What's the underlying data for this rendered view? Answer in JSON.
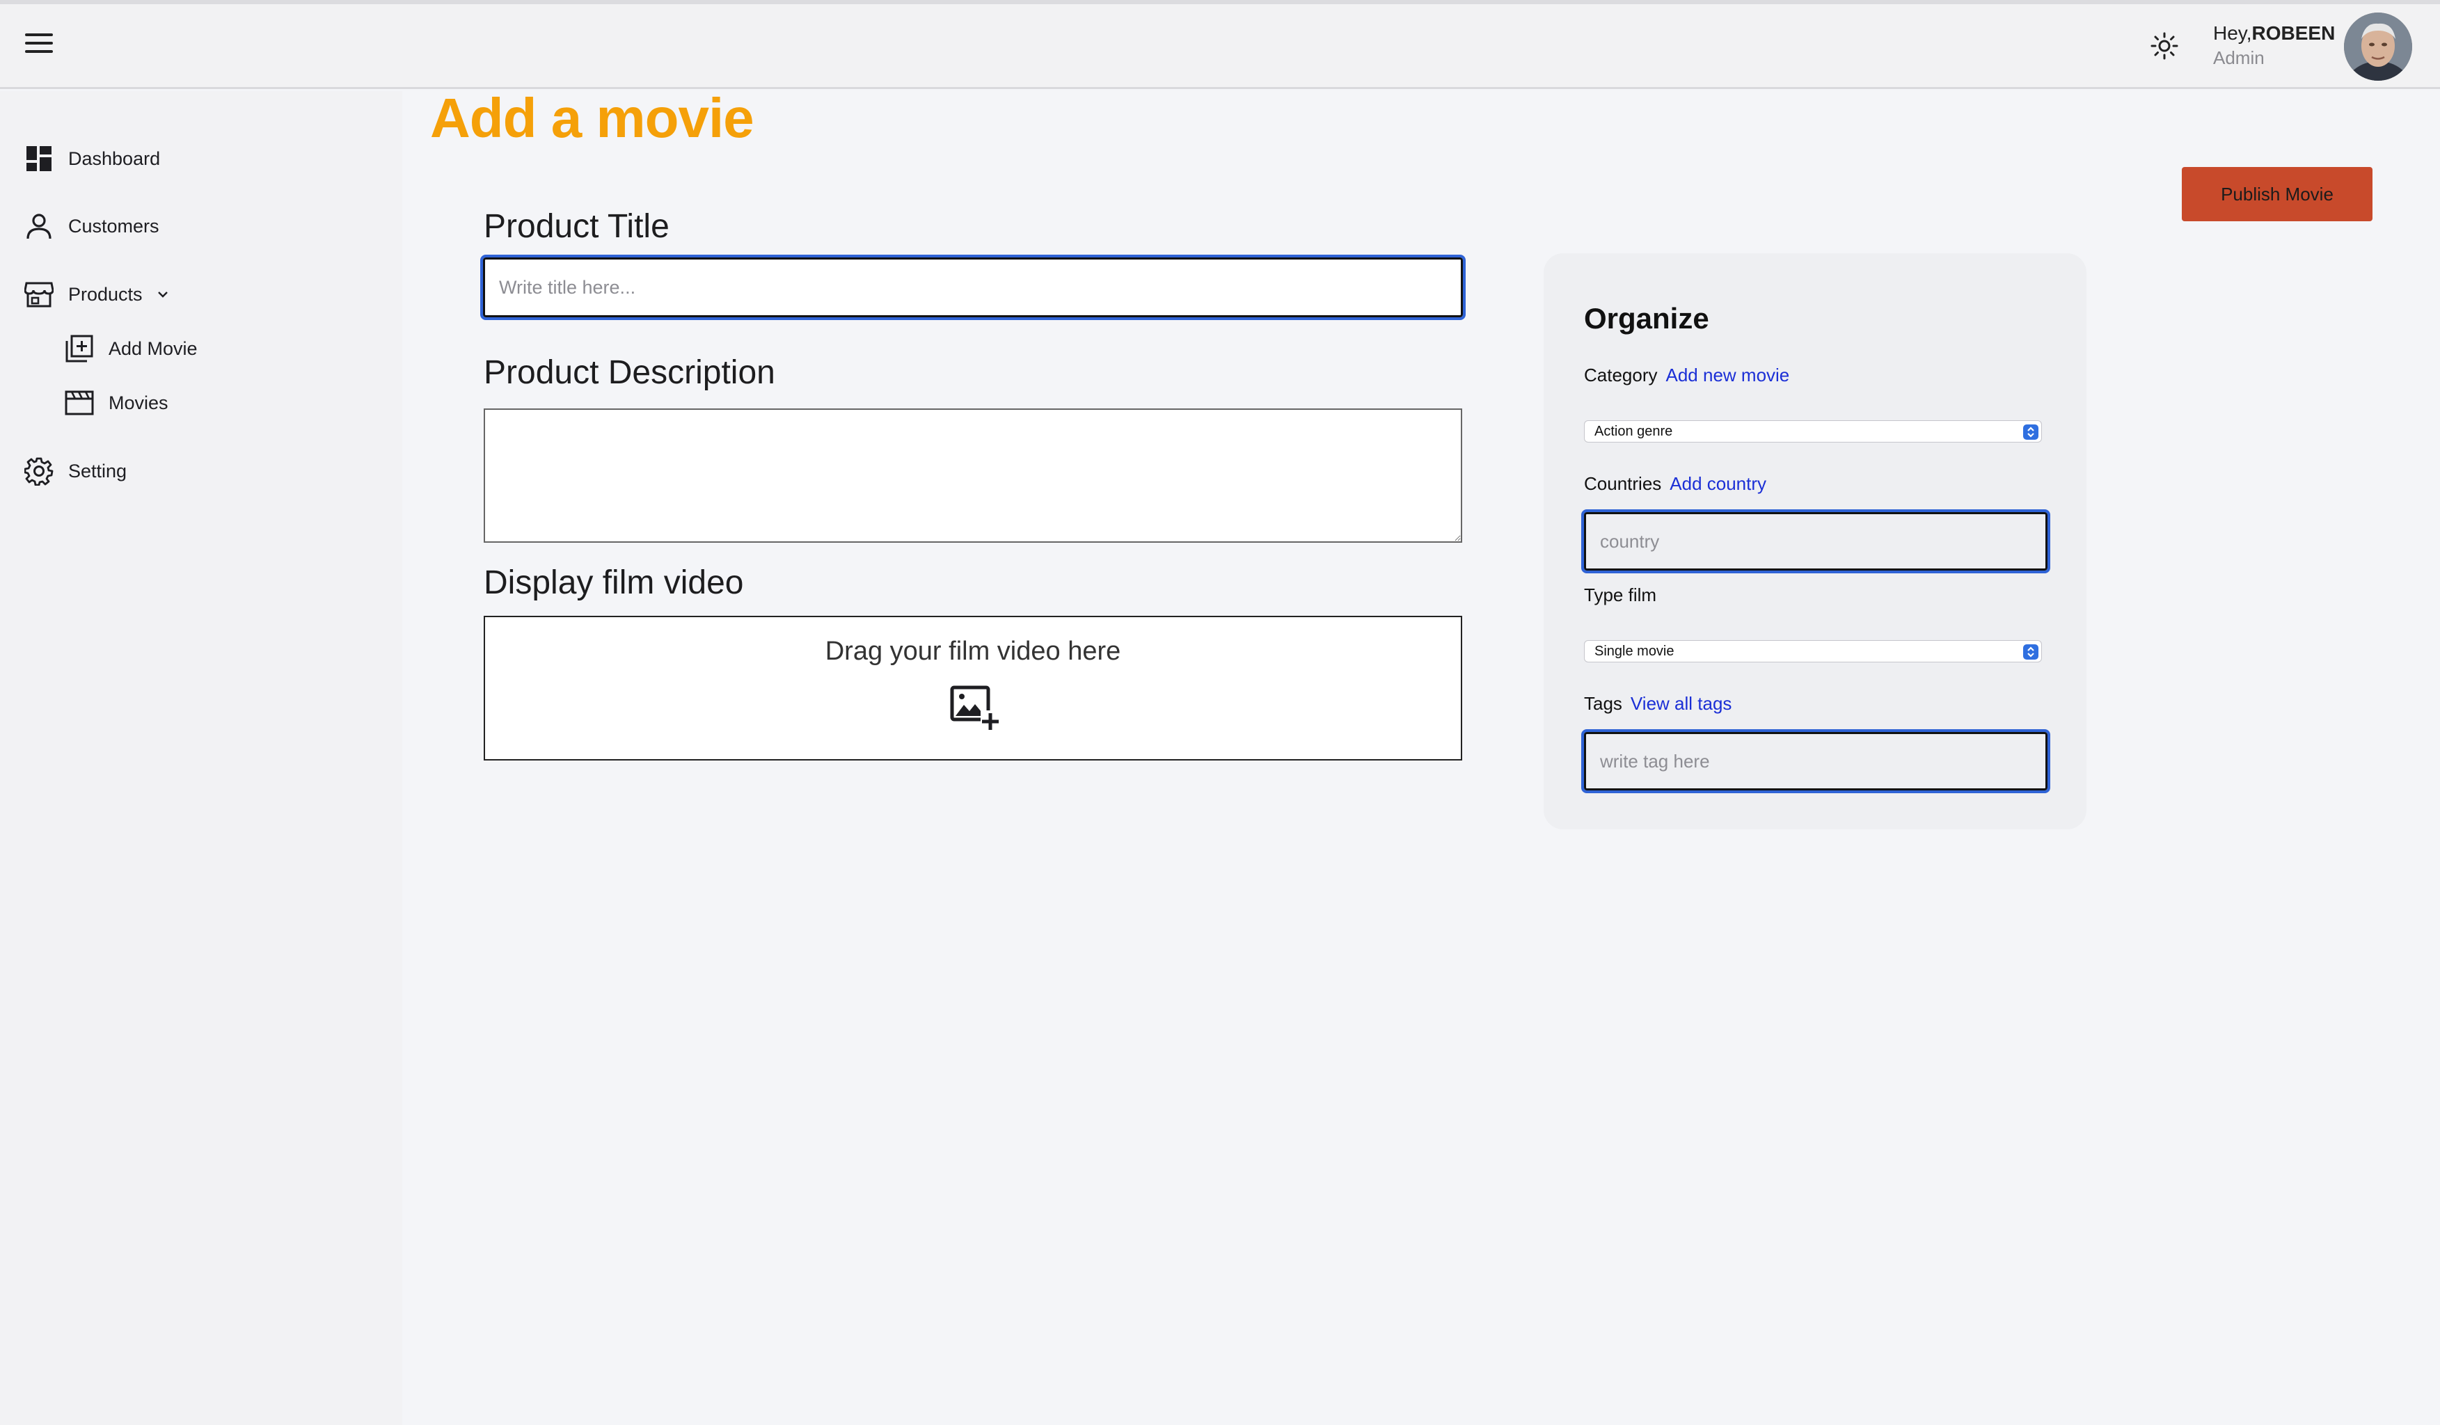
{
  "header": {
    "greeting_prefix": "Hey,",
    "user_name": "ROBEEN",
    "user_role": "Admin",
    "menu_icon": "hamburger-icon",
    "theme_icon": "sun-icon"
  },
  "sidebar": {
    "items": [
      {
        "label": "Dashboard",
        "icon": "dashboard-icon"
      },
      {
        "label": "Customers",
        "icon": "user-icon"
      },
      {
        "label": "Products",
        "icon": "store-icon"
      },
      {
        "label": "Add Movie",
        "icon": "add-box-icon"
      },
      {
        "label": "Movies",
        "icon": "clapperboard-icon"
      },
      {
        "label": "Setting",
        "icon": "gear-icon"
      }
    ]
  },
  "main": {
    "page_title": "Add a movie",
    "publish_label": "Publish Movie",
    "product_title_label": "Product Title",
    "product_title_placeholder": "Write title here...",
    "product_description_label": "Product Description",
    "display_video_label": "Display film video",
    "dropzone_text": "Drag your film video here"
  },
  "organize": {
    "title": "Organize",
    "category_label": "Category",
    "category_link": "Add new movie",
    "category_value": "Action genre",
    "countries_label": "Countries",
    "countries_link": "Add country",
    "country_placeholder": "country",
    "type_label": "Type film",
    "type_value": "Single movie",
    "tags_label": "Tags",
    "tags_link": "View all tags",
    "tags_placeholder": "write tag here"
  },
  "colors": {
    "title_accent": "#f5a009",
    "publish_button": "#c84a2b",
    "link": "#1b2fd6",
    "focus_ring": "#2f63d6"
  }
}
